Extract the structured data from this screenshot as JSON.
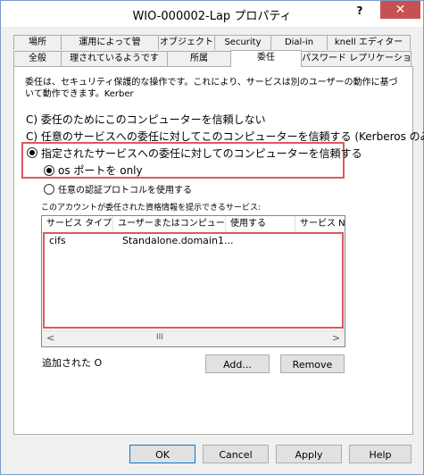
{
  "window": {
    "title": "WIO-000002-Lap プロパティ",
    "help_label": "?",
    "close_label": "✕"
  },
  "tabs_row1": [
    {
      "label": "場所"
    },
    {
      "label": "運用によって管"
    },
    {
      "label": "オブジェクト"
    },
    {
      "label": "Security"
    },
    {
      "label": "Dial-in"
    },
    {
      "label": "knell エディター"
    }
  ],
  "tabs_row2": [
    {
      "label": "全般"
    },
    {
      "label": "理されているようです"
    },
    {
      "label": "所属"
    },
    {
      "label": "委任"
    },
    {
      "label": "パスワード レプリケーション"
    }
  ],
  "delegation": {
    "description": "委任は、セキュリティ保護的な操作です。これにより、サービスは別のユーザーの動作に基づいて動作できます。Kerber",
    "opt_no_trust": "C) 委任のためにこのコンピューターを信頼しない",
    "opt_any_service": "C) 任意のサービスへの委任に対してこのコンピューターを信頼する (Kerberos のみ)",
    "opt_specified": "指定されたサービスへの委任に対してのコンピューターを信頼する",
    "sub_kerberos_only": "os ポートを only",
    "sub_any_protocol": "任意の認証プロトコルを使用する",
    "list_label": "このアカウントが委任された資格情報を提示できるサービス:"
  },
  "services_table": {
    "columns": [
      "サービス タイプ",
      "ユーザーまたはコンピューター",
      "使用する",
      "サービス N"
    ],
    "rows": [
      {
        "service_type": "cifs",
        "computer": "Standalone.domain1..."
      }
    ]
  },
  "scrollbar": {
    "left_arrow": "<",
    "thumb": "III",
    "right_arrow": ">"
  },
  "expanded_label": "追加された O",
  "buttons": {
    "add": "Add...",
    "remove": "Remove",
    "ok": "OK",
    "cancel": "Cancel",
    "apply": "Apply",
    "help": "Help"
  },
  "colors": {
    "highlight_box": "#e05660",
    "close_button": "#c75050",
    "focus_border": "#0078d7"
  }
}
